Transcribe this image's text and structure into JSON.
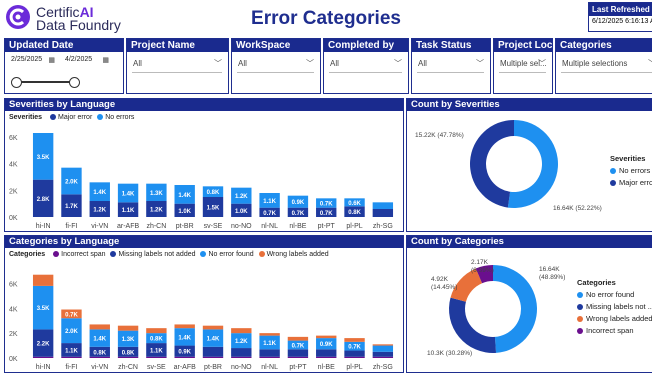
{
  "header": {
    "brand_line1_a": "Certific",
    "brand_line1_b": "AI",
    "brand_line2": "Data Foundry",
    "title": "Error Categories",
    "refresh_label": "Last Refreshed",
    "refresh_value": "6/12/2025 6:16:13 AM"
  },
  "slicers": {
    "updated_date": {
      "label": "Updated Date",
      "start": "2/25/2025",
      "end": "4/2/2025"
    },
    "project_name": {
      "label": "Project Name",
      "value": "All"
    },
    "workspace": {
      "label": "WorkSpace",
      "value": "All"
    },
    "completed_by": {
      "label": "Completed by",
      "value": "All"
    },
    "task_status": {
      "label": "Task Status",
      "value": "All"
    },
    "project_locale": {
      "label": "Project Locale",
      "value": "Multiple sel..."
    },
    "categories": {
      "label": "Categories",
      "value": "Multiple selections"
    }
  },
  "panels": {
    "severities_by_language": "Severities by Language",
    "count_by_severities": "Count by Severities",
    "categories_by_language": "Categories by Language",
    "count_by_categories": "Count by Categories"
  },
  "colors": {
    "navy": "#1a2a8e",
    "dark_blue": "#1f3a9e",
    "light_blue": "#1e90f0",
    "orange": "#e8703a",
    "purple": "#6a0f8e"
  },
  "chart_data": [
    {
      "id": "severities_by_language",
      "type": "bar",
      "legend_title": "Severities",
      "categories": [
        "hi-IN",
        "fi-FI",
        "vi-VN",
        "ar-AFB",
        "zh-CN",
        "pt-BR",
        "sv-SE",
        "no-NO",
        "nl-NL",
        "nl-BE",
        "pt-PT",
        "pl-PL",
        "zh-SG"
      ],
      "series": [
        {
          "name": "Major error",
          "color": "#1f3a9e",
          "values": [
            2.8,
            1.7,
            1.2,
            1.1,
            1.2,
            1.0,
            1.5,
            1.0,
            0.7,
            0.7,
            0.7,
            0.8,
            0.6
          ]
        },
        {
          "name": "No errors",
          "color": "#1e90f0",
          "values": [
            3.5,
            2.0,
            1.4,
            1.4,
            1.3,
            1.4,
            0.8,
            1.2,
            1.1,
            0.9,
            0.7,
            0.6,
            0.5
          ]
        }
      ],
      "labels": [
        [
          "2.8K",
          "1.7K",
          "1.2K",
          "1.1K",
          "1.2K",
          "1.0K",
          "1.5K",
          "1.0K",
          "0.7K",
          "0.7K",
          "0.7K",
          "0.8K",
          ""
        ],
        [
          "3.5K",
          "2.0K",
          "1.4K",
          "1.4K",
          "1.3K",
          "1.4K",
          "0.8K",
          "1.2K",
          "1.1K",
          "0.9K",
          "0.7K",
          "0.6K",
          ""
        ]
      ],
      "yticks": [
        "0K",
        "2K",
        "4K",
        "6K"
      ],
      "ylim": [
        0,
        6.6
      ]
    },
    {
      "id": "count_by_severities",
      "type": "pie",
      "legend_title": "Severities",
      "slices": [
        {
          "name": "No errors",
          "value": 16.64,
          "label": "16.64K (52.22%)",
          "color": "#1e90f0"
        },
        {
          "name": "Major error",
          "value": 15.22,
          "label": "15.22K (47.78%)",
          "color": "#1f3a9e"
        }
      ]
    },
    {
      "id": "categories_by_language",
      "type": "bar",
      "legend_title": "Categories",
      "categories": [
        "hi-IN",
        "fi-FI",
        "vi-VN",
        "zh-CN",
        "sv-SE",
        "ar-AFB",
        "pt-BR",
        "no-NO",
        "nl-NL",
        "pt-PT",
        "nl-BE",
        "pl-PL",
        "zh-SG"
      ],
      "series": [
        {
          "name": "Incorrect span",
          "color": "#6a0f8e",
          "values": [
            0.1,
            0.1,
            0.1,
            0.1,
            0.1,
            0.1,
            0.1,
            0.1,
            0.1,
            0.1,
            0.1,
            0.1,
            0.1
          ]
        },
        {
          "name": "Missing labels not added",
          "color": "#1f3a9e",
          "values": [
            2.2,
            1.1,
            0.8,
            0.8,
            1.1,
            0.9,
            0.8,
            0.7,
            0.6,
            0.6,
            0.6,
            0.5,
            0.4
          ]
        },
        {
          "name": "No error found",
          "color": "#1e90f0",
          "values": [
            3.5,
            2.0,
            1.4,
            1.3,
            0.8,
            1.4,
            1.4,
            1.2,
            1.1,
            0.7,
            0.9,
            0.7,
            0.5
          ]
        },
        {
          "name": "Wrong labels added",
          "color": "#e8703a",
          "values": [
            0.9,
            0.7,
            0.4,
            0.4,
            0.4,
            0.3,
            0.3,
            0.4,
            0.2,
            0.3,
            0.2,
            0.3,
            0.1
          ]
        }
      ],
      "labels": [
        [
          "",
          "",
          "",
          "",
          "",
          "",
          "",
          "",
          "",
          "",
          "",
          "",
          ""
        ],
        [
          "2.2K",
          "1.1K",
          "0.8K",
          "0.8K",
          "1.1K",
          "0.9K",
          "",
          "",
          "",
          "",
          "",
          "",
          ""
        ],
        [
          "3.5K",
          "2.0K",
          "1.4K",
          "1.3K",
          "0.8K",
          "1.4K",
          "1.4K",
          "1.2K",
          "1.1K",
          "0.7K",
          "0.9K",
          "0.7K",
          ""
        ],
        [
          "",
          "0.7K",
          "",
          "",
          "",
          "",
          "",
          "",
          "",
          "",
          "",
          "",
          ""
        ]
      ],
      "yticks": [
        "0K",
        "2K",
        "4K",
        "6K"
      ],
      "ylim": [
        0,
        7.4
      ]
    },
    {
      "id": "count_by_categories",
      "type": "pie",
      "legend_title": "Categories",
      "slices": [
        {
          "name": "No error found",
          "value": 16.64,
          "label": "16.64K (48.89%)",
          "color": "#1e90f0"
        },
        {
          "name": "Missing labels not ...",
          "value": 10.3,
          "label": "10.3K (30.28%)",
          "color": "#1f3a9e"
        },
        {
          "name": "Wrong labels added",
          "value": 4.92,
          "label": "4.92K (14.45%)",
          "color": "#e8703a"
        },
        {
          "name": "Incorrect span",
          "value": 2.17,
          "label": "2.17K (6.39%)",
          "color": "#6a0f8e"
        }
      ]
    }
  ]
}
